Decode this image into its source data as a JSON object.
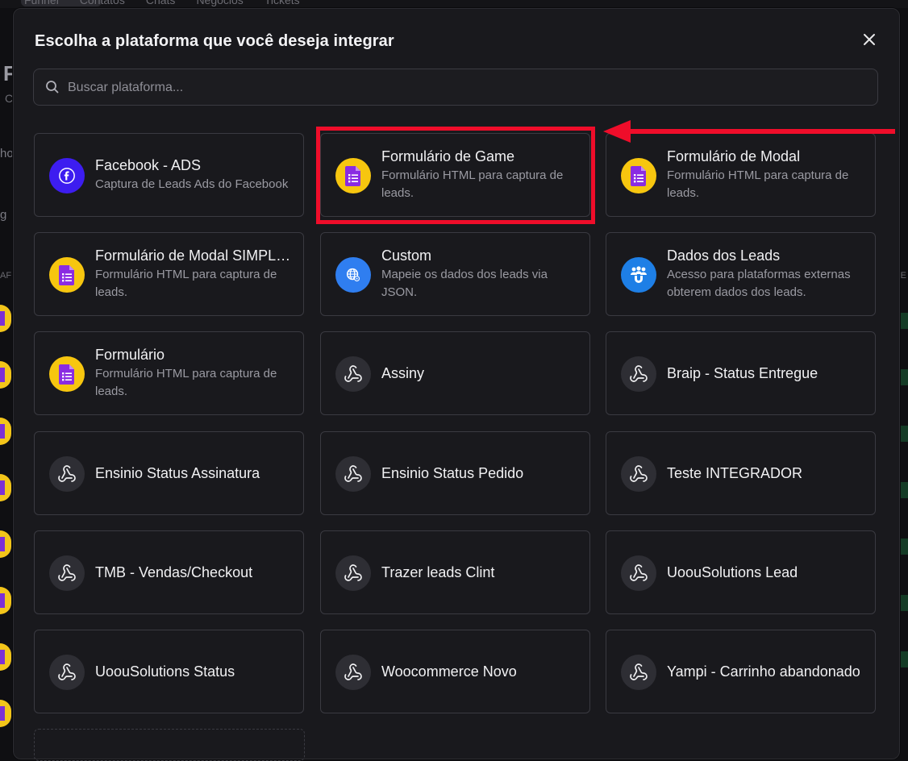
{
  "background": {
    "nav_items": [
      "Funnel",
      "Contatos",
      "Chats",
      "Negócios",
      "Tickets"
    ],
    "page_letter": "F",
    "page_sub": "C",
    "tab_fragment": "ho",
    "lead_fragment": "g",
    "col_left": "AF",
    "col_right": "E"
  },
  "modal": {
    "title": "Escolha a plataforma que você deseja integrar",
    "close_label": "×",
    "search_placeholder": "Buscar plataforma..."
  },
  "platforms": [
    {
      "name": "Facebook - ADS",
      "desc": "Captura de Leads Ads do Facebook",
      "icon": "facebook-icon"
    },
    {
      "name": "Formulário de Game",
      "desc": "Formulário HTML para captura de leads.",
      "icon": "form-icon"
    },
    {
      "name": "Formulário de Modal",
      "desc": "Formulário HTML para captura de leads.",
      "icon": "form-icon"
    },
    {
      "name": "Formulário de Modal SIMPLES",
      "desc": "Formulário HTML para captura de leads.",
      "icon": "form-icon"
    },
    {
      "name": "Custom",
      "desc": "Mapeie os dados dos leads via JSON.",
      "icon": "globe-icon"
    },
    {
      "name": "Dados dos Leads",
      "desc": "Acesso para plataformas externas obterem dados dos leads.",
      "icon": "users-icon"
    },
    {
      "name": "Formulário",
      "desc": "Formulário HTML para captura de leads.",
      "icon": "form-icon"
    },
    {
      "name": "Assiny",
      "desc": "",
      "icon": "webhook-icon"
    },
    {
      "name": "Braip - Status Entregue",
      "desc": "",
      "icon": "webhook-icon"
    },
    {
      "name": "Ensinio Status Assinatura",
      "desc": "",
      "icon": "webhook-icon"
    },
    {
      "name": "Ensinio Status Pedido",
      "desc": "",
      "icon": "webhook-icon"
    },
    {
      "name": "Teste INTEGRADOR",
      "desc": "",
      "icon": "webhook-icon"
    },
    {
      "name": "TMB - Vendas/Checkout",
      "desc": "",
      "icon": "webhook-icon"
    },
    {
      "name": "Trazer leads Clint",
      "desc": "",
      "icon": "webhook-icon"
    },
    {
      "name": "UoouSolutions Lead",
      "desc": "",
      "icon": "webhook-icon"
    },
    {
      "name": "UoouSolutions Status",
      "desc": "",
      "icon": "webhook-icon"
    },
    {
      "name": "Woocommerce Novo",
      "desc": "",
      "icon": "webhook-icon"
    },
    {
      "name": "Yampi - Carrinho abandonado",
      "desc": "",
      "icon": "webhook-icon"
    }
  ],
  "annotation": {
    "highlight_color": "#ef0d2a",
    "highlighted_item": "Formulário de Game"
  },
  "colors": {
    "modal_bg": "#19191d",
    "card_border": "#3a3a41",
    "facebook": "#3d1df0",
    "form": "#f7c60f",
    "form_inner": "#8a2be2",
    "globe": "#2f7ef0",
    "users": "#1e7fe6",
    "webhook": "#2e2e34"
  }
}
